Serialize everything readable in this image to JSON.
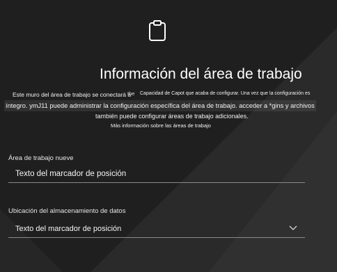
{
  "header": {
    "title": "Información del área de trabajo",
    "icon": "clipboard-icon"
  },
  "description": {
    "line1_a": "Este muro del área de trabajo se conectará a",
    "line1_b": "the",
    "line1_c": "Capacidad de Capot que acaba de configurar. Una vez que la configuración es",
    "line2": "íntegro. ymJ11 puede administrar la configuración específica del área de trabajo. acceder a *gins y archivos",
    "line3": "también puede configurar áreas de trabajo adicionales.",
    "line4": "Más información sobre las áreas de trabajo"
  },
  "form": {
    "new_workspace": {
      "label": "Área de trabajo nueve",
      "value": "Texto del marcador de posición"
    },
    "storage_location": {
      "label": "Ubicación del almacenamiento de datos",
      "value": "Texto del marcador de posición",
      "icon": "chevron-down-icon"
    }
  },
  "colors": {
    "background": "#1f1f1f",
    "background_shape": "#2b2b2b",
    "text": "#ffffff",
    "underline": "#8a8a8a"
  }
}
